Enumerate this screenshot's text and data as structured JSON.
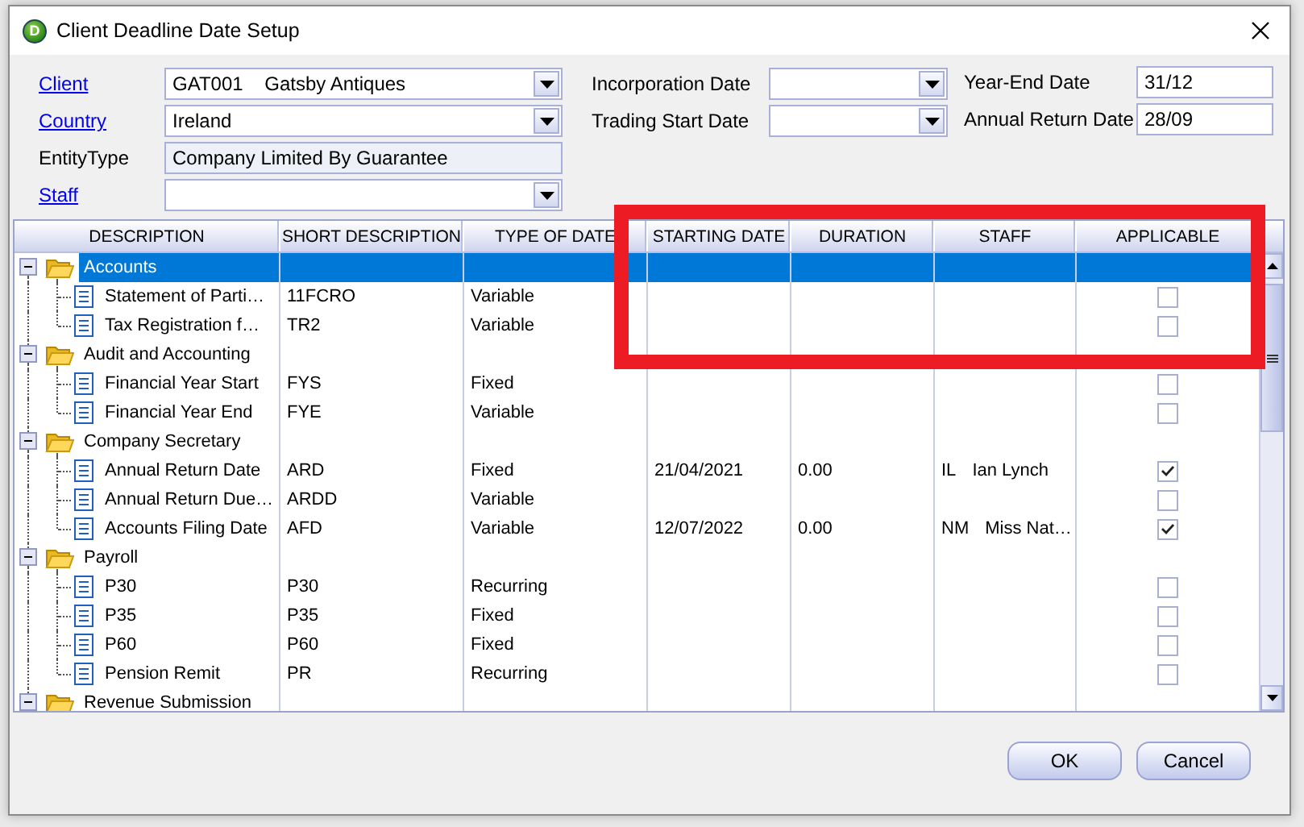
{
  "window": {
    "title": "Client Deadline Date Setup",
    "icon_letter": "D"
  },
  "form": {
    "left": [
      {
        "label": "Client",
        "link": true,
        "kind": "combo",
        "code": "GAT001",
        "value": "Gatsby Antiques"
      },
      {
        "label": "Country",
        "link": true,
        "kind": "combo",
        "value": "Ireland"
      },
      {
        "label": "EntityType",
        "link": false,
        "kind": "readonly",
        "value": "Company Limited By Guarantee"
      },
      {
        "label": "Staff",
        "link": true,
        "kind": "combo"
      }
    ],
    "middle": [
      {
        "label": "Incorporation Date",
        "link": false,
        "kind": "combo"
      },
      {
        "label": "Trading Start Date",
        "link": false,
        "kind": "combo"
      }
    ],
    "right": [
      {
        "label": "Year-End Date",
        "link": false,
        "kind": "text",
        "value": "31/12"
      },
      {
        "label": "Annual Return Date",
        "link": false,
        "kind": "text",
        "value": "28/09"
      }
    ]
  },
  "table": {
    "columns": [
      "DESCRIPTION",
      "SHORT DESCRIPTION",
      "TYPE OF DATE",
      "STARTING DATE",
      "DURATION",
      "STAFF",
      "APPLICABLE"
    ],
    "groups": [
      {
        "description": "Accounts",
        "selected": true,
        "expanded": true,
        "children": [
          {
            "description": "Statement of Parti…",
            "short": "11FCRO",
            "type": "Variable",
            "applicable": false
          },
          {
            "description": "Tax Registration f…",
            "short": "TR2",
            "type": "Variable",
            "applicable": false
          }
        ]
      },
      {
        "description": "Audit and Accounting",
        "selected": false,
        "expanded": true,
        "children": [
          {
            "description": "Financial Year Start",
            "short": "FYS",
            "type": "Fixed",
            "applicable": false
          },
          {
            "description": "Financial Year End",
            "short": "FYE",
            "type": "Variable",
            "applicable": false
          }
        ]
      },
      {
        "description": "Company Secretary",
        "selected": false,
        "expanded": true,
        "children": [
          {
            "description": "Annual Return Date",
            "short": "ARD",
            "type": "Fixed",
            "starting_date": "21/04/2021",
            "duration": "0.00",
            "staff_code": "IL",
            "staff_name": "Ian Lynch",
            "applicable": true
          },
          {
            "description": "Annual Return Due…",
            "short": "ARDD",
            "type": "Variable",
            "applicable": false
          },
          {
            "description": "Accounts Filing Date",
            "short": "AFD",
            "type": "Variable",
            "starting_date": "12/07/2022",
            "duration": "0.00",
            "staff_code": "NM",
            "staff_name": "Miss Nat…",
            "applicable": true
          }
        ]
      },
      {
        "description": "Payroll",
        "selected": false,
        "expanded": true,
        "children": [
          {
            "description": "P30",
            "short": "P30",
            "type": "Recurring",
            "applicable": false
          },
          {
            "description": "P35",
            "short": "P35",
            "type": "Fixed",
            "applicable": false
          },
          {
            "description": "P60",
            "short": "P60",
            "type": "Fixed",
            "applicable": false
          },
          {
            "description": "Pension Remit",
            "short": "PR",
            "type": "Recurring",
            "applicable": false
          }
        ]
      },
      {
        "description": "Revenue Submission",
        "selected": false,
        "expanded": true
      }
    ]
  },
  "buttons": [
    "OK",
    "Cancel"
  ]
}
